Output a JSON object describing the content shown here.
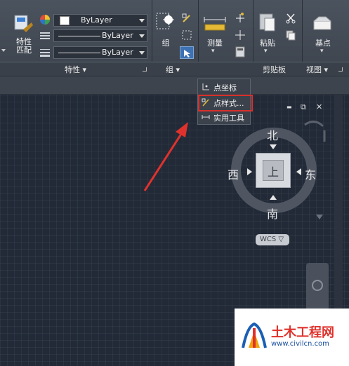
{
  "properties": {
    "match_label": "特性\n匹配",
    "color_value": "ByLayer",
    "linetype_value": "ByLayer",
    "lineweight_value": "ByLayer",
    "panel_title": "特性 ▾"
  },
  "group": {
    "label": "组",
    "panel_title": "组 ▾"
  },
  "measure": {
    "label": "测量",
    "arrow": "▾"
  },
  "clipboard": {
    "paste_label": "粘贴",
    "paste_arrow": "▾",
    "panel_title": "剪贴板"
  },
  "view": {
    "panel_title": "视图 ▾"
  },
  "base": {
    "label": "基点",
    "arrow": "▾"
  },
  "popup_menu": {
    "items": [
      "点坐标",
      "点样式...",
      "实用工具"
    ]
  },
  "viewport_controls": {
    "minimize": "▬",
    "restore": "⧉",
    "close": "✕"
  },
  "viewcube": {
    "north": "北",
    "south": "南",
    "east": "东",
    "west": "西",
    "cube_face": "上",
    "wcs_label": "WCS ▽"
  },
  "watermark": {
    "title": "土木工程网",
    "url": "www.civilcn.com"
  },
  "colors": {
    "accent_red": "#e0322c",
    "highlight_box": "#d9302b"
  }
}
